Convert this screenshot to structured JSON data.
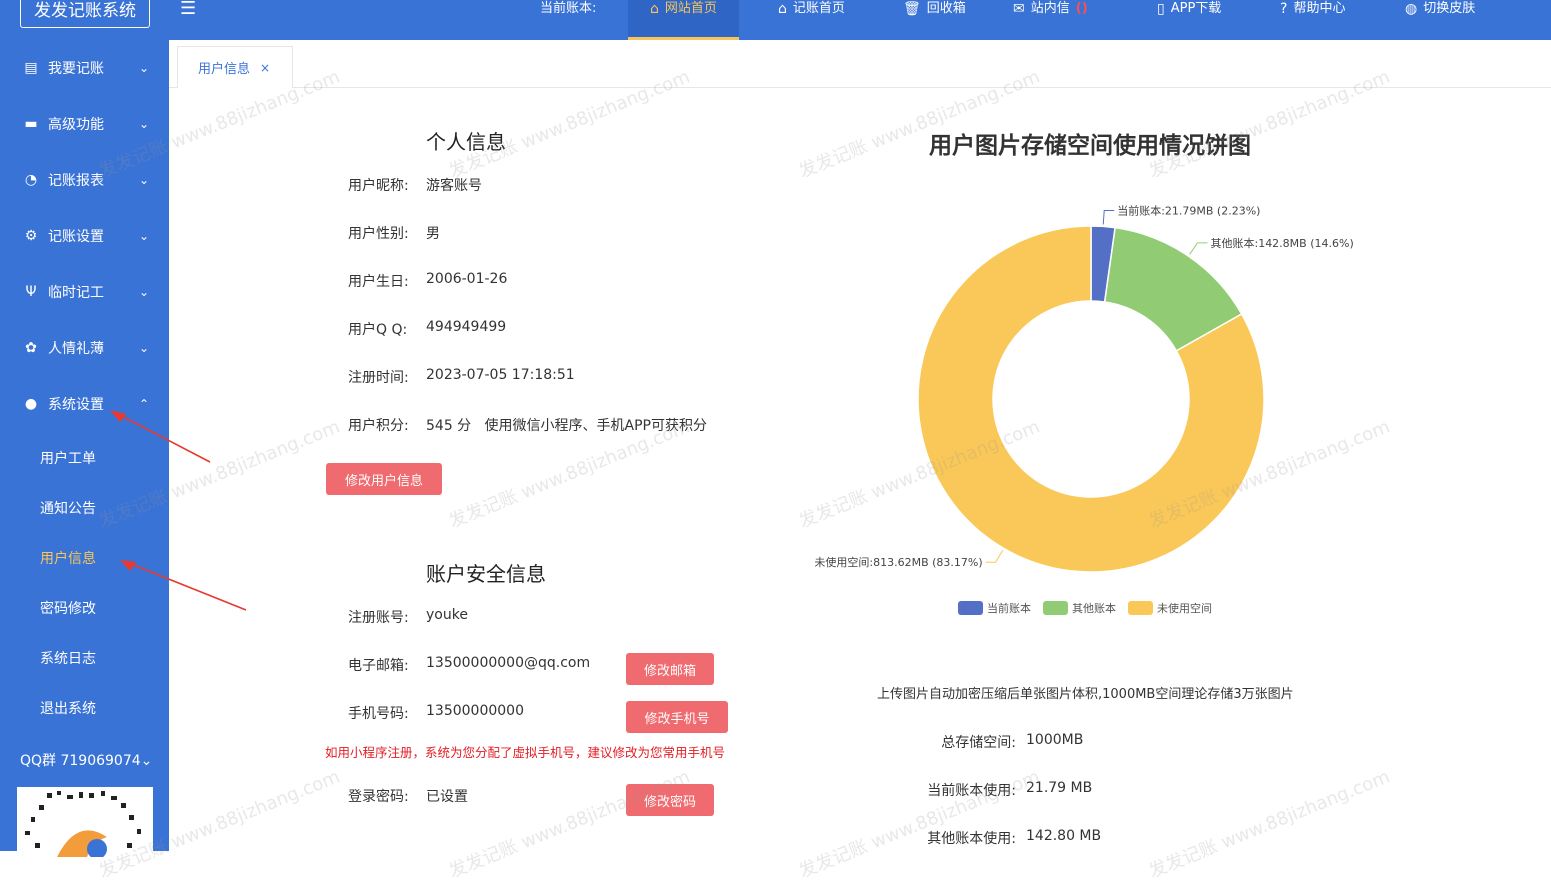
{
  "app": {
    "title": "发发记账系统",
    "menu_icon": "hamburger-icon"
  },
  "topnav": {
    "current_book_label": "当前账本:",
    "items": [
      {
        "label": "网站首页",
        "icon": "home-icon",
        "active": true
      },
      {
        "label": "记账首页",
        "icon": "home-icon"
      },
      {
        "label": "回收箱",
        "icon": "trash-icon"
      },
      {
        "label": "站内信",
        "icon": "mail-icon",
        "badge": "()"
      },
      {
        "label": "APP下载",
        "icon": "phone-icon"
      },
      {
        "label": "帮助中心",
        "icon": "help-icon"
      },
      {
        "label": "切换皮肤",
        "icon": "palette-icon"
      }
    ]
  },
  "sidebar": {
    "items": [
      {
        "label": "我要记账",
        "icon": "ledger-icon"
      },
      {
        "label": "高级功能",
        "icon": "briefcase-icon"
      },
      {
        "label": "记账报表",
        "icon": "pie-chart-icon"
      },
      {
        "label": "记账设置",
        "icon": "gear-icon"
      },
      {
        "label": "临时记工",
        "icon": "tools-icon"
      },
      {
        "label": "人情礼薄",
        "icon": "gift-icon"
      },
      {
        "label": "系统设置",
        "icon": "user-icon",
        "expanded": true
      }
    ],
    "subitems": [
      {
        "label": "用户工单"
      },
      {
        "label": "通知公告"
      },
      {
        "label": "用户信息",
        "active": true
      },
      {
        "label": "密码修改"
      },
      {
        "label": "系统日志"
      },
      {
        "label": "退出系统"
      }
    ],
    "qq_group": "QQ群 719069074"
  },
  "tab": {
    "label": "用户信息",
    "close": "×"
  },
  "personal": {
    "title": "个人信息",
    "rows": [
      {
        "label": "用户昵称:",
        "value": "游客账号"
      },
      {
        "label": "用户性别:",
        "value": "男"
      },
      {
        "label": "用户生日:",
        "value": "2006-01-26"
      },
      {
        "label": "用户Q Q:",
        "value": "494949499"
      },
      {
        "label": "注册时间:",
        "value": "2023-07-05 17:18:51"
      },
      {
        "label": "用户积分:",
        "value": "545 分   使用微信小程序、手机APP可获积分"
      }
    ],
    "edit_button": "修改用户信息"
  },
  "security": {
    "title": "账户安全信息",
    "account_label": "注册账号:",
    "account_value": "youke",
    "email_label": "电子邮箱:",
    "email_value": "13500000000@qq.com",
    "email_button": "修改邮箱",
    "phone_label": "手机号码:",
    "phone_value": "13500000000",
    "phone_button": "修改手机号",
    "warning": "如用小程序注册，系统为您分配了虚拟手机号，建议修改为您常用手机号",
    "password_label": "登录密码:",
    "password_value": "已设置",
    "password_button": "修改密码"
  },
  "storage": {
    "note": "上传图片自动加密压缩后单张图片体积,1000MB空间理论存储3万张图片",
    "stats": [
      {
        "label": "总存储空间:",
        "value": "1000MB"
      },
      {
        "label": "当前账本使用:",
        "value": "21.79 MB"
      },
      {
        "label": "其他账本使用:",
        "value": "142.80 MB"
      }
    ]
  },
  "chart_data": {
    "type": "pie",
    "title": "用户图片存储空间使用情况饼图",
    "slices": [
      {
        "name": "当前账本",
        "value": 21.79,
        "label": "当前账本:21.79MB  (2.23%)",
        "color": "#5470c6"
      },
      {
        "name": "其他账本",
        "value": 142.8,
        "label": "其他账本:142.8MB  (14.6%)",
        "color": "#91cc75"
      },
      {
        "name": "未使用空间",
        "value": 813.62,
        "label": "未使用空间:813.62MB  (83.17%)",
        "color": "#fac858"
      }
    ],
    "donut": true,
    "legend_position": "bottom"
  },
  "watermark": "发发记账 www.88jizhang.com"
}
